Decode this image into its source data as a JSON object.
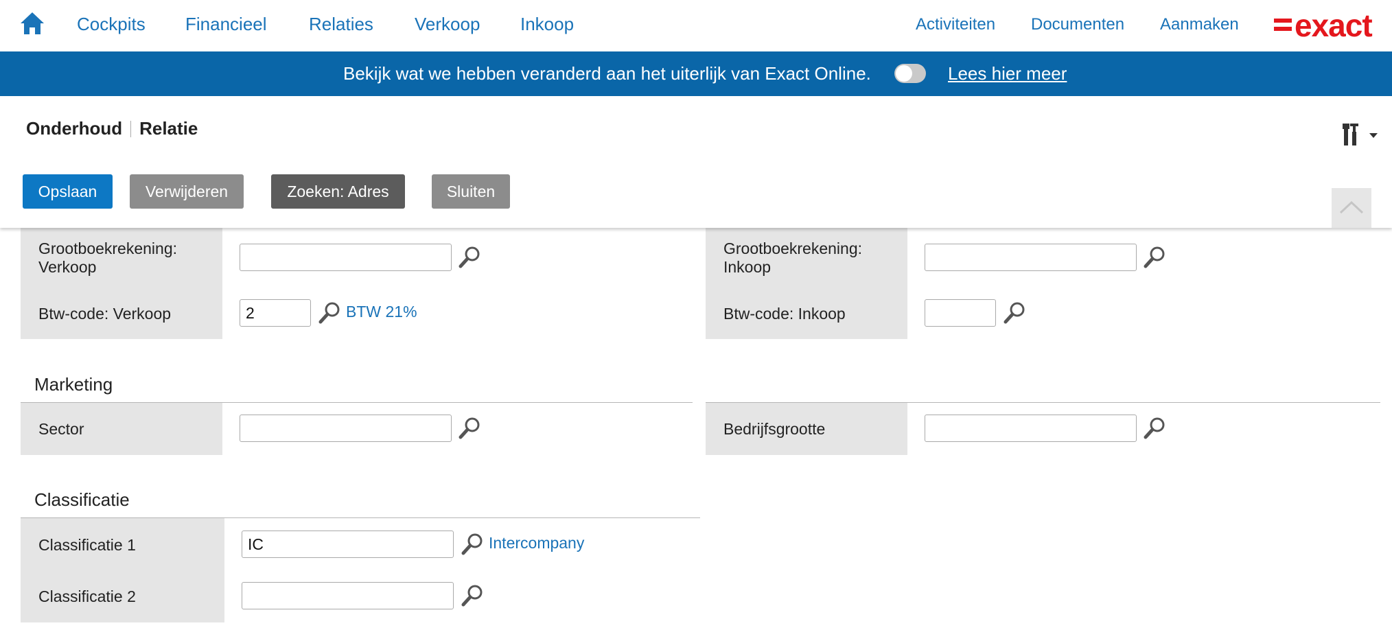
{
  "nav": {
    "home_icon": "home-icon",
    "items": [
      "Cockpits",
      "Financieel",
      "Relaties",
      "Verkoop",
      "Inkoop"
    ],
    "right_items": [
      "Activiteiten",
      "Documenten",
      "Aanmaken"
    ],
    "brand": "exact",
    "brand_color": "#e4171d",
    "link_color": "#1a73b8"
  },
  "banner": {
    "text": "Bekijk wat we hebben veranderd aan het uiterlijk van Exact Online.",
    "toggle_on": false,
    "link": "Lees hier meer",
    "background": "#0a66a8"
  },
  "header": {
    "breadcrumb": [
      "Onderhoud",
      "Relatie"
    ],
    "tools_icon": "tools-icon"
  },
  "toolbar": {
    "save": "Opslaan",
    "delete": "Verwijderen",
    "search_address": "Zoeken: Adres",
    "close": "Sluiten"
  },
  "form": {
    "gl_sales": {
      "label": "Grootboekrekening: Verkoop",
      "label_line1": "Grootboekrekening:",
      "label_line2": "Verkoop",
      "value": ""
    },
    "gl_purchase": {
      "label": "Grootboekrekening: Inkoop",
      "label_line1": "Grootboekrekening:",
      "label_line2": "Inkoop",
      "value": ""
    },
    "vat_sales": {
      "label": "Btw-code: Verkoop",
      "value": "2",
      "description": "BTW 21%"
    },
    "vat_purchase": {
      "label": "Btw-code: Inkoop",
      "value": ""
    },
    "marketing": {
      "title": "Marketing",
      "sector": {
        "label": "Sector",
        "value": ""
      },
      "company_size": {
        "label": "Bedrijfsgrootte",
        "value": ""
      }
    },
    "classification": {
      "title": "Classificatie",
      "class1": {
        "label": "Classificatie 1",
        "value": "IC",
        "description": "Intercompany"
      },
      "class2": {
        "label": "Classificatie 2",
        "value": ""
      }
    }
  }
}
